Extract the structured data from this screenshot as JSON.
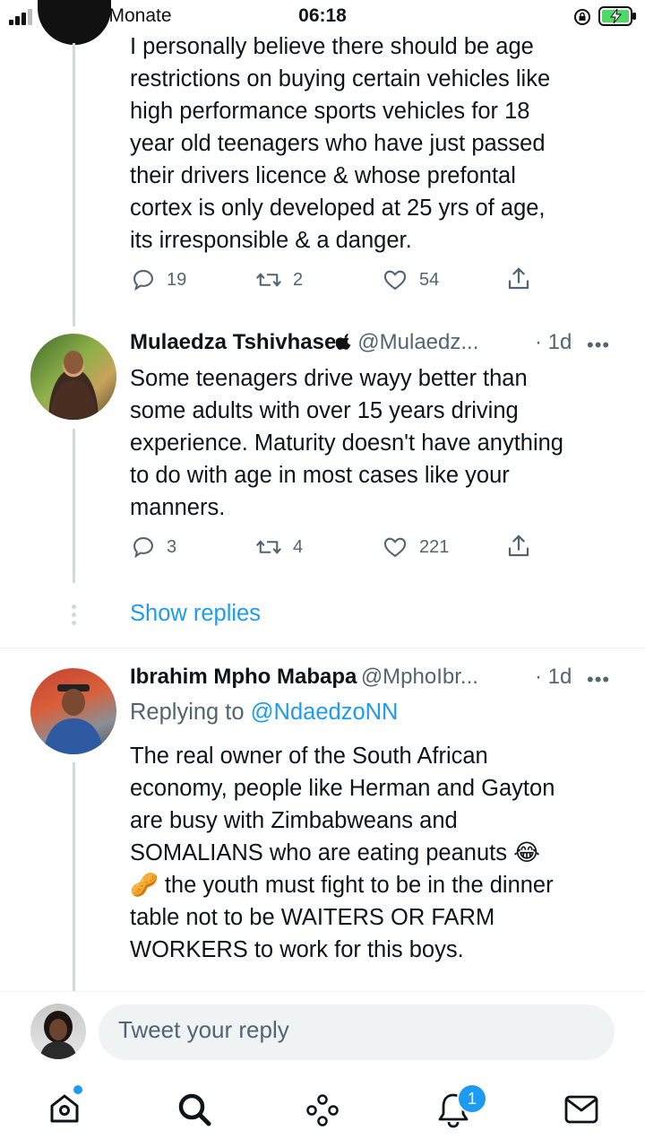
{
  "status_bar": {
    "carrier": "Telkom-Monate",
    "time": "06:18"
  },
  "tweets": [
    {
      "text_lines": [
        "I personally believe there should be age",
        "restrictions on buying certain vehicles like",
        "high performance sports vehicles for 18",
        "year old teenagers who have just passed",
        "their drivers licence & whose prefontal",
        "cortex is only developed at 25 yrs of age,",
        "its irresponsible & a danger."
      ],
      "replies": "19",
      "retweets": "2",
      "likes": "54"
    },
    {
      "name": "Mulaedza Tshivhase",
      "handle": "@Mulaedz...",
      "time": "· 1d",
      "text_lines": [
        "Some teenagers drive wayy better than",
        "some adults with over 15 years driving",
        "experience. Maturity doesn't have anything",
        "to do with age in most cases like your",
        "manners."
      ],
      "replies": "3",
      "retweets": "4",
      "likes": "221"
    },
    {
      "name": "Ibrahim Mpho Mabapa",
      "handle": "@MphoIbr...",
      "time": "· 1d",
      "replying_prefix": "Replying to",
      "replying_to": "@NdaedzoNN",
      "text_lines": [
        "The real owner of the South African",
        "economy, people like Herman and Gayton",
        "are busy with Zimbabweans and",
        "SOMALIANS who are eating peanuts 😂",
        "🥜 the youth must fight to be in the dinner",
        "table not to be WAITERS OR FARM",
        "WORKERS to work for this boys."
      ]
    }
  ],
  "show_replies": "Show replies",
  "reply_placeholder": "Tweet your reply",
  "nav": {
    "notification_count": "1"
  },
  "colors": {
    "accent": "#1d9bf0",
    "muted": "#536471",
    "thread_line": "#cfd9de"
  }
}
